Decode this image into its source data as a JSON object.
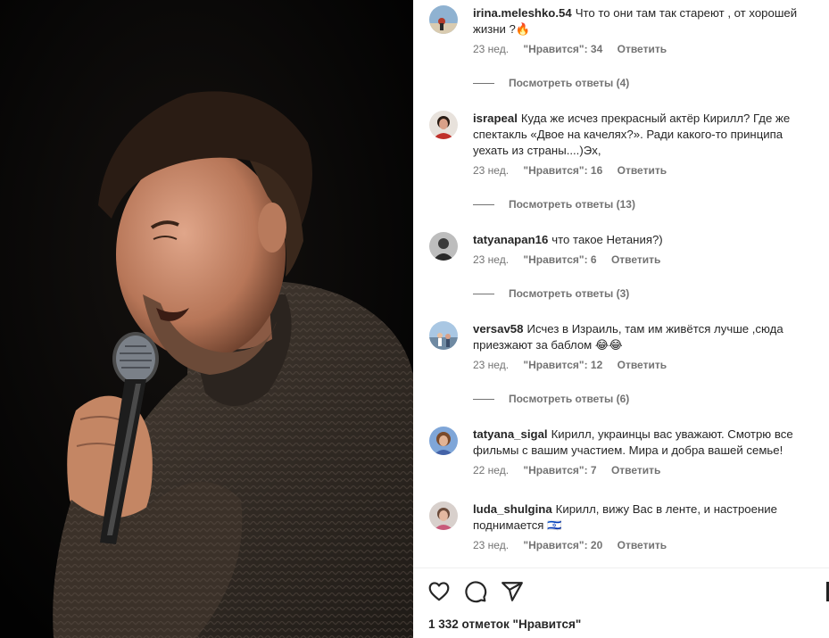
{
  "post": {
    "likes_text": "1 332 отметок \"Нравится\""
  },
  "comments": [
    {
      "username": "irina.meleshko.54",
      "text": "Что то они там так стареют , от хорошей жизни ?🔥",
      "time": "23 нед.",
      "likes": "\"Нравится\": 34",
      "reply": "Ответить",
      "view_replies": "Посмотреть ответы (4)"
    },
    {
      "username": "israpeal",
      "text": "Куда же исчез прекрасный актёр Кирилл? Где же спектакль «Двое на качелях?». Ради какого-то принципа уехать из страны....)Эх,",
      "time": "23 нед.",
      "likes": "\"Нравится\": 16",
      "reply": "Ответить",
      "view_replies": "Посмотреть ответы (13)"
    },
    {
      "username": "tatyanapan16",
      "text": "что такое Нетания?)",
      "time": "23 нед.",
      "likes": "\"Нравится\": 6",
      "reply": "Ответить",
      "view_replies": "Посмотреть ответы (3)"
    },
    {
      "username": "versav58",
      "text": "Исчез в Израиль, там им живётся лучше ,сюда приезжают за баблом 😂😂",
      "time": "23 нед.",
      "likes": "\"Нравится\": 12",
      "reply": "Ответить",
      "view_replies": "Посмотреть ответы (6)"
    },
    {
      "username": "tatyana_sigal",
      "text": "Кирилл, украинцы вас уважают. Смотрю все фильмы с вашим участием. Мира и добра вашей семье!",
      "time": "22 нед.",
      "likes": "\"Нравится\": 7",
      "reply": "Ответить"
    },
    {
      "username": "luda_shulgina",
      "text": "Кирилл, вижу Вас в ленте, и настроение поднимается 🇮🇱",
      "time": "23 нед.",
      "likes": "\"Нравится\": 20",
      "reply": "Ответить"
    }
  ],
  "icons": {
    "like": "heart-icon",
    "comment": "comment-icon",
    "share": "share-icon"
  },
  "colors": {
    "text": "#262626",
    "secondary": "#737373",
    "divider": "#efefef"
  }
}
